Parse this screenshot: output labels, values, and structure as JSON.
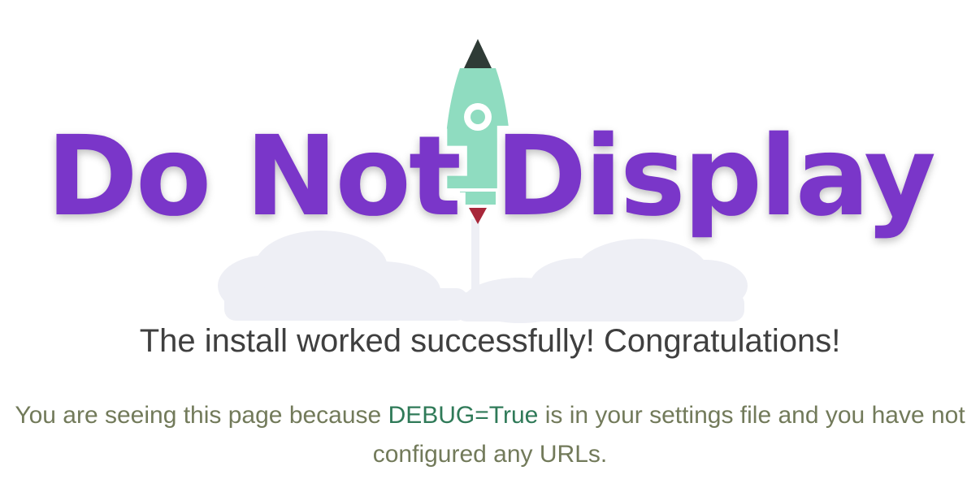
{
  "overlay": {
    "text": "Do Not Display",
    "color": "#7a36c9"
  },
  "hero": {
    "rocket_body_color": "#8fdcc0",
    "rocket_nose_color": "#2f3b36",
    "rocket_flame_color": "#a8273a",
    "cloud_color": "#eeeff5"
  },
  "main": {
    "headline": "The install worked successfully! Congratulations!",
    "subtext_part1": "You are seeing this page because ",
    "debug_flag": "DEBUG=True",
    "subtext_part2": " is in your settings file and you have not configured any URLs."
  }
}
